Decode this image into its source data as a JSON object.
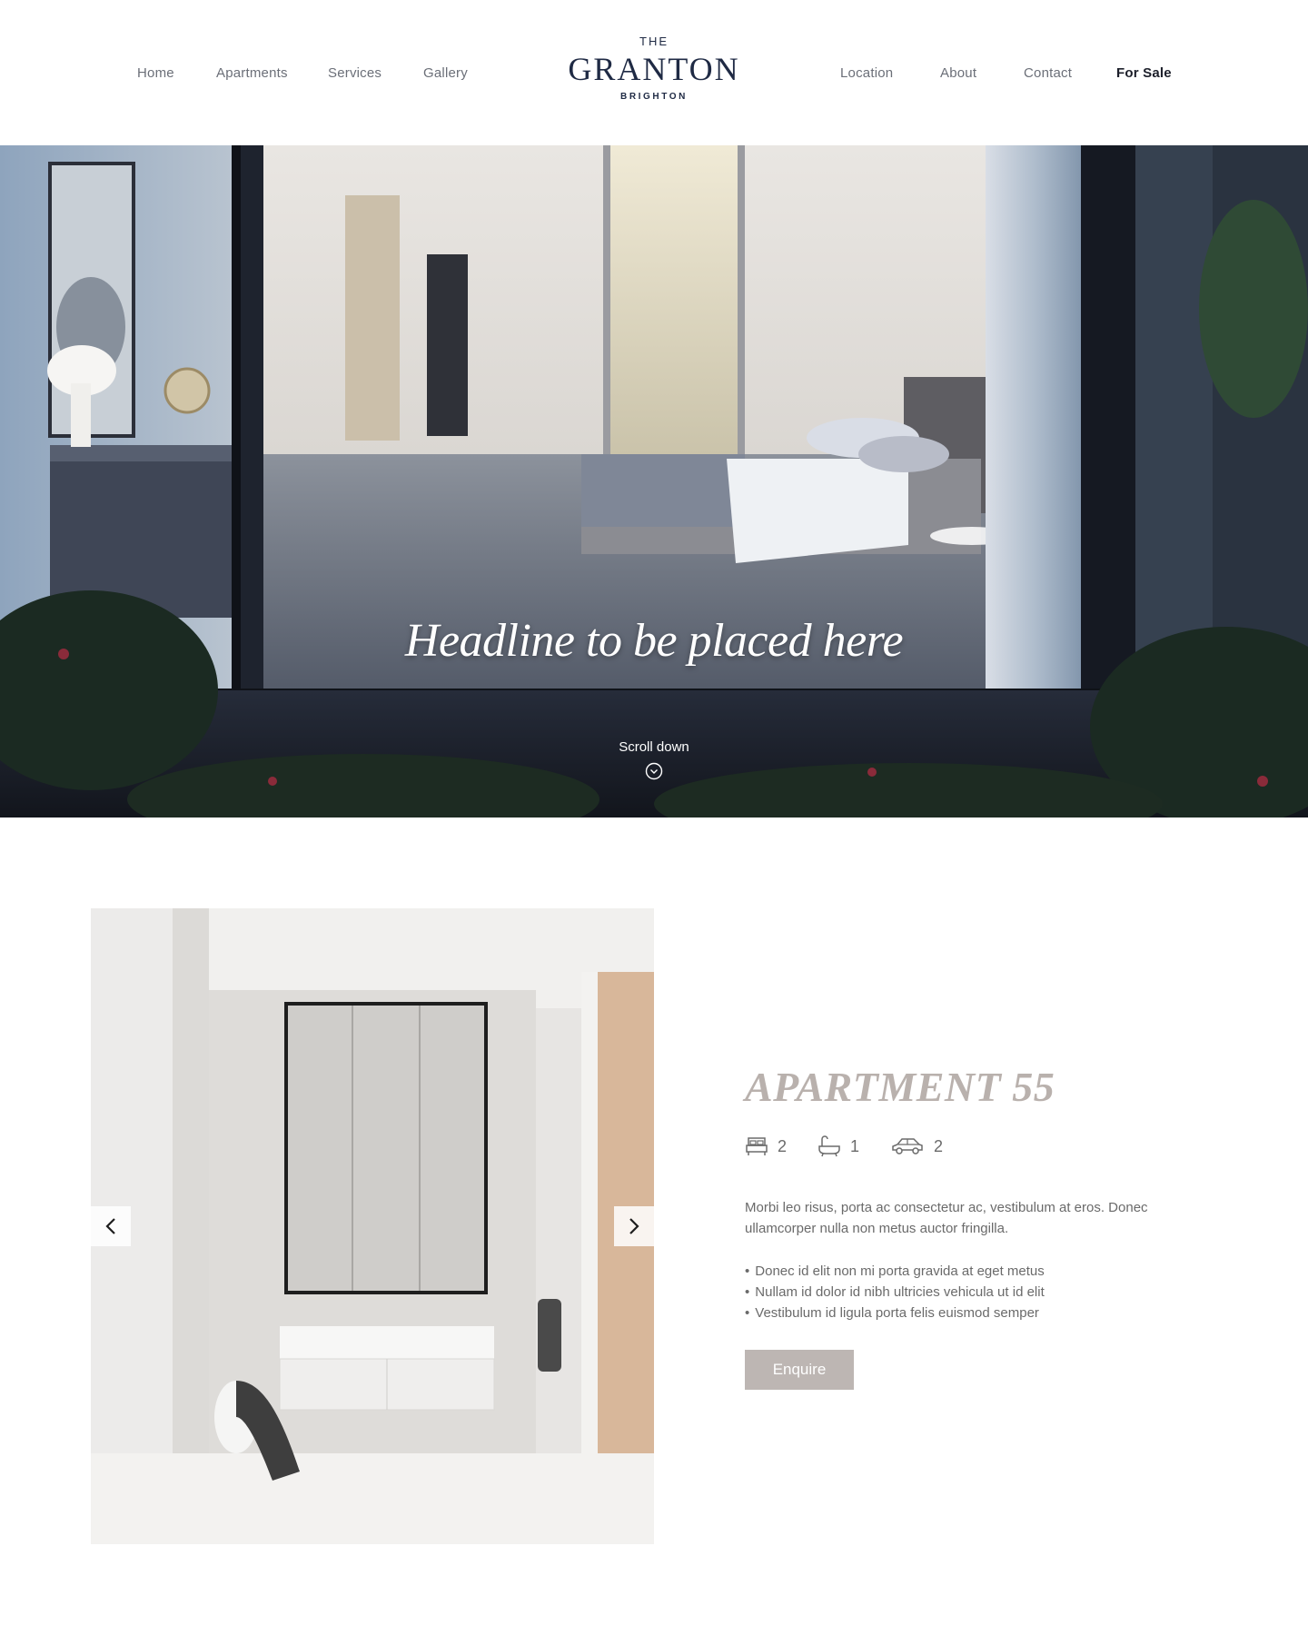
{
  "nav": {
    "left": [
      "Home",
      "Apartments",
      "Services",
      "Gallery"
    ],
    "right": [
      "Location",
      "About",
      "Contact",
      "For Sale"
    ]
  },
  "logo": {
    "the": "THE",
    "name": "GRANTON",
    "sub": "BRIGHTON"
  },
  "hero": {
    "headline": "Headline to be placed here",
    "scroll_label": "Scroll down"
  },
  "apartment": {
    "title": "APARTMENT 55",
    "features": [
      {
        "icon": "bed-icon",
        "value": "2"
      },
      {
        "icon": "bath-icon",
        "value": "1"
      },
      {
        "icon": "car-icon",
        "value": "2"
      }
    ],
    "description": "Morbi leo risus, porta ac consectetur ac, vestibulum at eros. Donec ullamcorper nulla non metus auctor fringilla.",
    "bullets": [
      "Donec id elit non mi porta gravida at eget metus",
      "Nullam id dolor id nibh ultricies vehicula ut id elit",
      "Vestibulum id ligula porta felis euismod semper"
    ],
    "enquire_label": "Enquire"
  },
  "colors": {
    "logo": "#1f2a44",
    "nav_text": "#6b6f78",
    "title_accent": "#b9b1ad",
    "button_bg": "#bdb6b3"
  }
}
